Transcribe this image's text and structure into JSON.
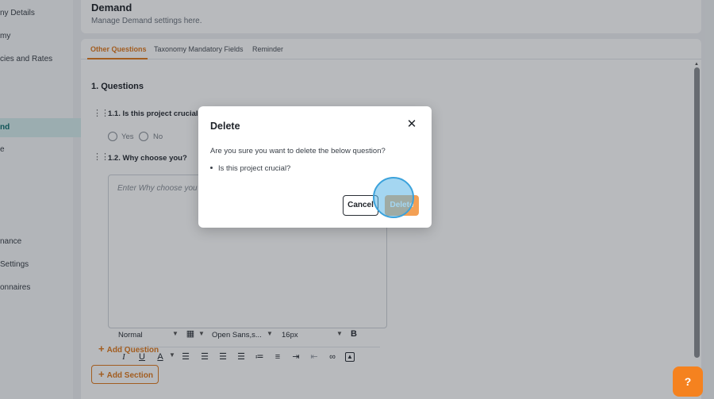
{
  "sidebar": {
    "items": [
      {
        "label": "ny Details"
      },
      {
        "label": "my"
      },
      {
        "label": "cies and Rates"
      },
      {
        "label": "nd"
      },
      {
        "label": "e"
      },
      {
        "label": "nance"
      },
      {
        "label": " Settings"
      },
      {
        "label": "onnaires"
      }
    ]
  },
  "header": {
    "title": "Demand",
    "subtitle": "Manage Demand settings here."
  },
  "tabs": [
    {
      "label": "Other Questions"
    },
    {
      "label": "Taxonomy Mandatory Fields"
    },
    {
      "label": "Reminder"
    }
  ],
  "form": {
    "section_title": "1. Questions",
    "q1_label": "1.1. Is this project crucial?",
    "yes_label": "Yes",
    "no_label": "No",
    "q2_label": "1.2. Why choose you?",
    "editor_placeholder": "Enter Why choose you",
    "toolbar": {
      "format": "Normal",
      "font": "Open Sans,s...",
      "size": "16px",
      "bold": "B",
      "italic": "I",
      "underline": "U",
      "color": "A"
    },
    "add_question": "Add Question",
    "add_section": "Add Section",
    "plus": "+"
  },
  "modal": {
    "title": "Delete",
    "close": "✕",
    "message": "Are you sure you want to delete the below question?",
    "item": "Is this project crucial?",
    "cancel": "Cancel",
    "delete": "Delete"
  },
  "help": {
    "icon": "?"
  },
  "colors": {
    "accent": "#e07a1f",
    "delete_button": "#f3a055",
    "active_nav_bg": "#d6ecec",
    "help_fab": "#f5821f"
  }
}
